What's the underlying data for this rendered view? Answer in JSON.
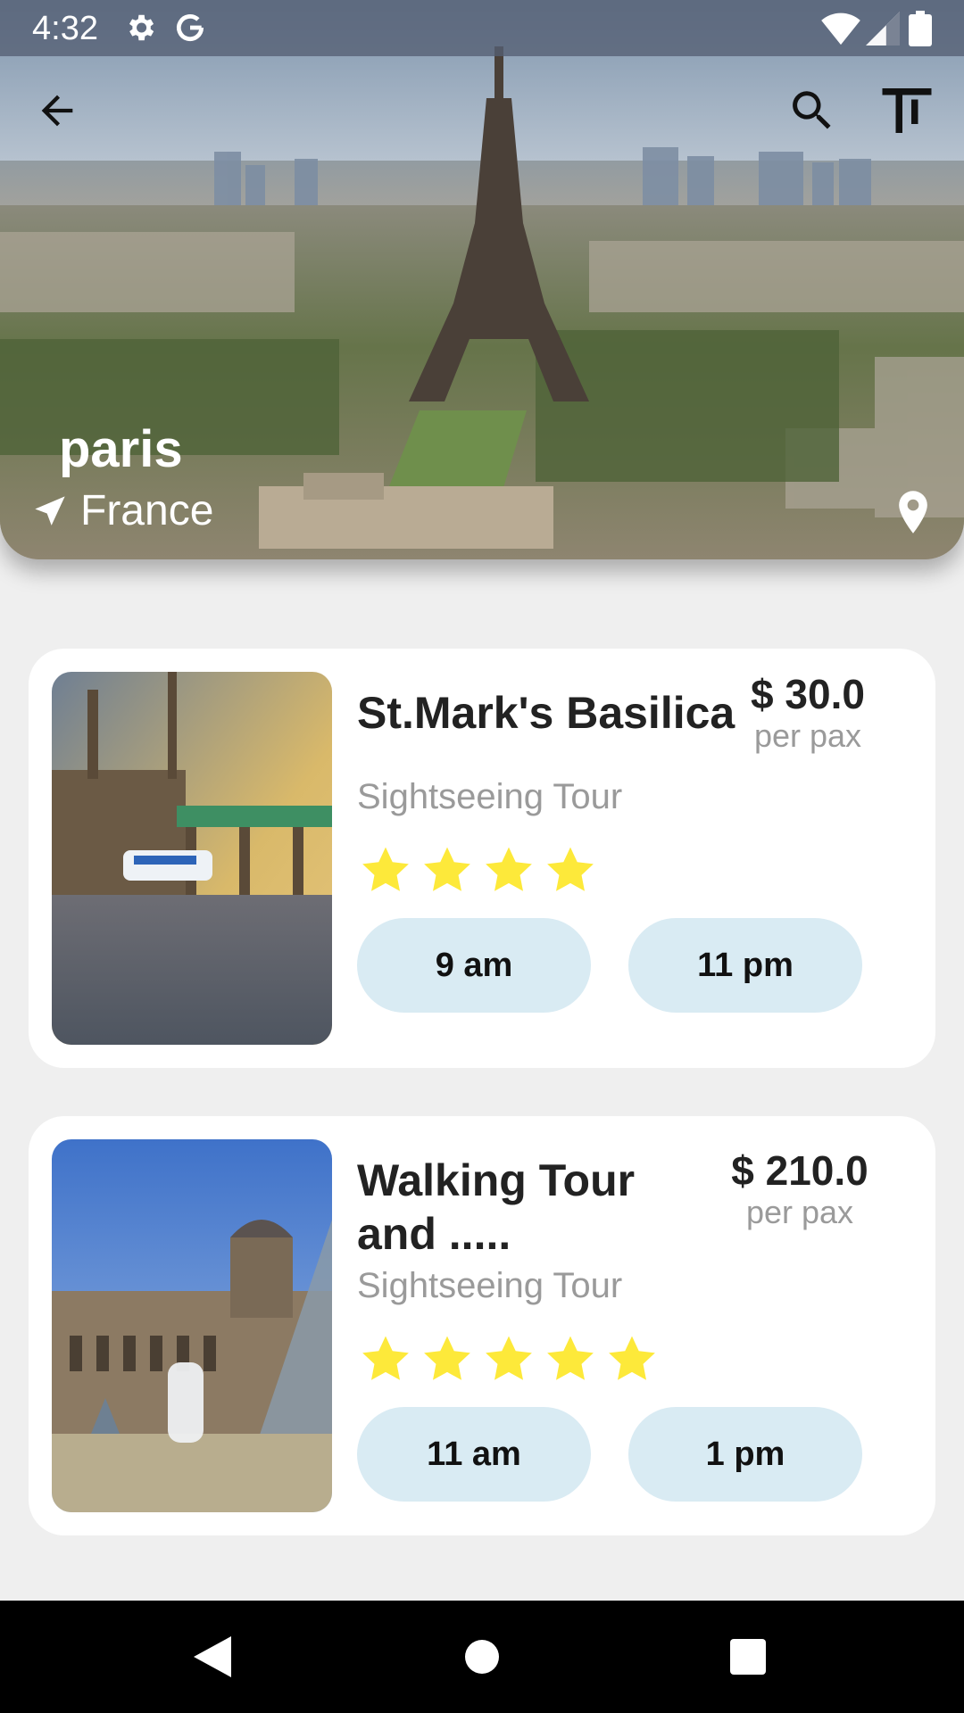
{
  "status_bar": {
    "time": "4:32",
    "icons": [
      "settings-icon",
      "google-g-icon",
      "wifi-icon",
      "signal-icon",
      "battery-icon"
    ]
  },
  "app_bar": {
    "icons": [
      "back-arrow-icon",
      "search-icon",
      "text-size-icon"
    ]
  },
  "hero": {
    "city": "paris",
    "country": "France",
    "icons": [
      "navigation-arrow-icon",
      "location-pin-icon"
    ]
  },
  "tours": [
    {
      "title": "St.Mark's Basilica",
      "price": "$ 30.0",
      "price_unit": "per pax",
      "category": "Sightseeing Tour",
      "rating": 4,
      "times": [
        "9 am",
        "11 pm"
      ]
    },
    {
      "title": "Walking Tour and .....",
      "price": "$ 210.0",
      "price_unit": "per pax",
      "category": "Sightseeing Tour",
      "rating": 5,
      "times": [
        "11 am",
        "1 pm"
      ]
    }
  ],
  "nav_bar": {
    "icons": [
      "nav-back-icon",
      "nav-home-icon",
      "nav-recents-icon"
    ]
  },
  "colors": {
    "background": "#efefef",
    "card": "#ffffff",
    "chip": "#d9ebf3",
    "star": "#fde93a",
    "muted_text": "#9a9a9a"
  }
}
